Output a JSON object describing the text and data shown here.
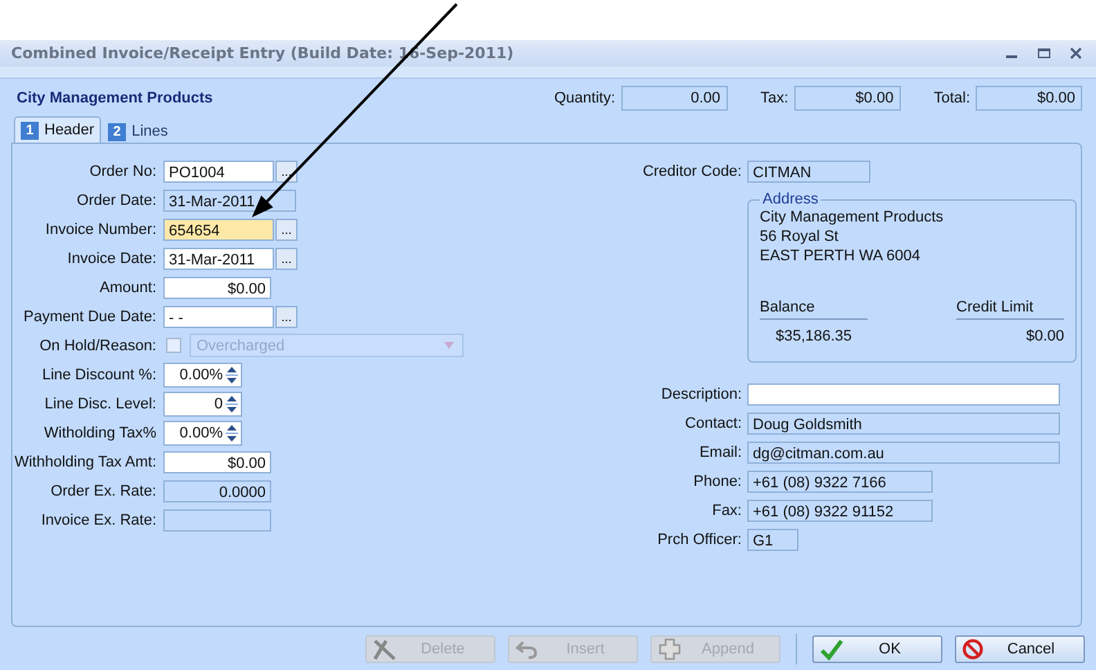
{
  "window": {
    "title": "Combined Invoice/Receipt Entry (Build Date: 16-Sep-2011)"
  },
  "company": "City Management Products",
  "totals": [
    {
      "label": "Quantity:",
      "value": "0.00"
    },
    {
      "label": "Tax:",
      "value": "$0.00"
    },
    {
      "label": "Total:",
      "value": "$0.00"
    }
  ],
  "tabs": [
    {
      "number": "1",
      "label": "Header",
      "selected": true
    },
    {
      "number": "2",
      "label": "Lines",
      "selected": false
    }
  ],
  "left_fields": [
    {
      "kind": "lookup",
      "label": "Order No:",
      "value": "PO1004",
      "button": "...",
      "focused": false
    },
    {
      "kind": "readonly",
      "label": "Order Date:",
      "value": "31-Mar-2011",
      "focused": false
    },
    {
      "kind": "lookup",
      "label": "Invoice Number:",
      "value": "654654",
      "button": "...",
      "focused": true
    },
    {
      "kind": "lookup",
      "label": "Invoice Date:",
      "value": "31-Mar-2011",
      "button": "...",
      "focused": false
    },
    {
      "kind": "amount",
      "label": "Amount:",
      "value": "$0.00",
      "focused": false
    },
    {
      "kind": "lookup",
      "label": "Payment Due Date:",
      "value": "- -",
      "button": "...",
      "focused": false
    },
    {
      "kind": "hold",
      "label": "On Hold/Reason:",
      "value": "Overcharged",
      "checked": false,
      "disabled": true,
      "focused": false
    },
    {
      "kind": "spin",
      "label": "Line Discount %:",
      "value": "0.00%",
      "focused": false
    },
    {
      "kind": "spin",
      "label": "Line Disc. Level:",
      "value": "0",
      "focused": false
    },
    {
      "kind": "spin",
      "label": "Witholding Tax%",
      "value": "0.00%",
      "focused": false
    },
    {
      "kind": "amount",
      "label": "Withholding Tax Amt:",
      "value": "$0.00",
      "focused": false
    },
    {
      "kind": "readonly_number",
      "label": "Order Ex. Rate:",
      "value": "0.0000",
      "focused": false
    },
    {
      "kind": "readonly_number",
      "label": "Invoice Ex. Rate:",
      "focused": false
    }
  ],
  "creditor_code": {
    "label": "Creditor Code:",
    "value": "CITMAN"
  },
  "address": {
    "title": "Address",
    "lines": [
      "City Management Products",
      "56 Royal St",
      "EAST PERTH WA 6004"
    ],
    "balance_label": "Balance",
    "balance": "$35,186.35",
    "credit_limit_label": "Credit Limit",
    "credit_limit": "$0.00"
  },
  "right_fields": [
    {
      "kind": "entry",
      "label": "Description:"
    },
    {
      "kind": "wide",
      "label": "Contact:",
      "value": "Doug Goldsmith"
    },
    {
      "kind": "wide",
      "label": "Email:",
      "value": "dg@citman.com.au"
    },
    {
      "kind": "medium",
      "label": "Phone:",
      "value": "+61 (08) 9322 7166"
    },
    {
      "kind": "medium",
      "label": "Fax:",
      "value": "+61 (08) 9322 91152"
    },
    {
      "kind": "small",
      "label": "Prch Officer:",
      "value": "G1"
    }
  ],
  "buttons": [
    {
      "kind": "delete",
      "label": "Delete",
      "disabled": true
    },
    {
      "kind": "insert",
      "label": "Insert",
      "disabled": true
    },
    {
      "kind": "append",
      "label": "Append",
      "disabled": true
    },
    {
      "kind": "ok",
      "label": "OK",
      "disabled": false
    },
    {
      "kind": "cancel",
      "label": "Cancel",
      "disabled": false
    }
  ]
}
